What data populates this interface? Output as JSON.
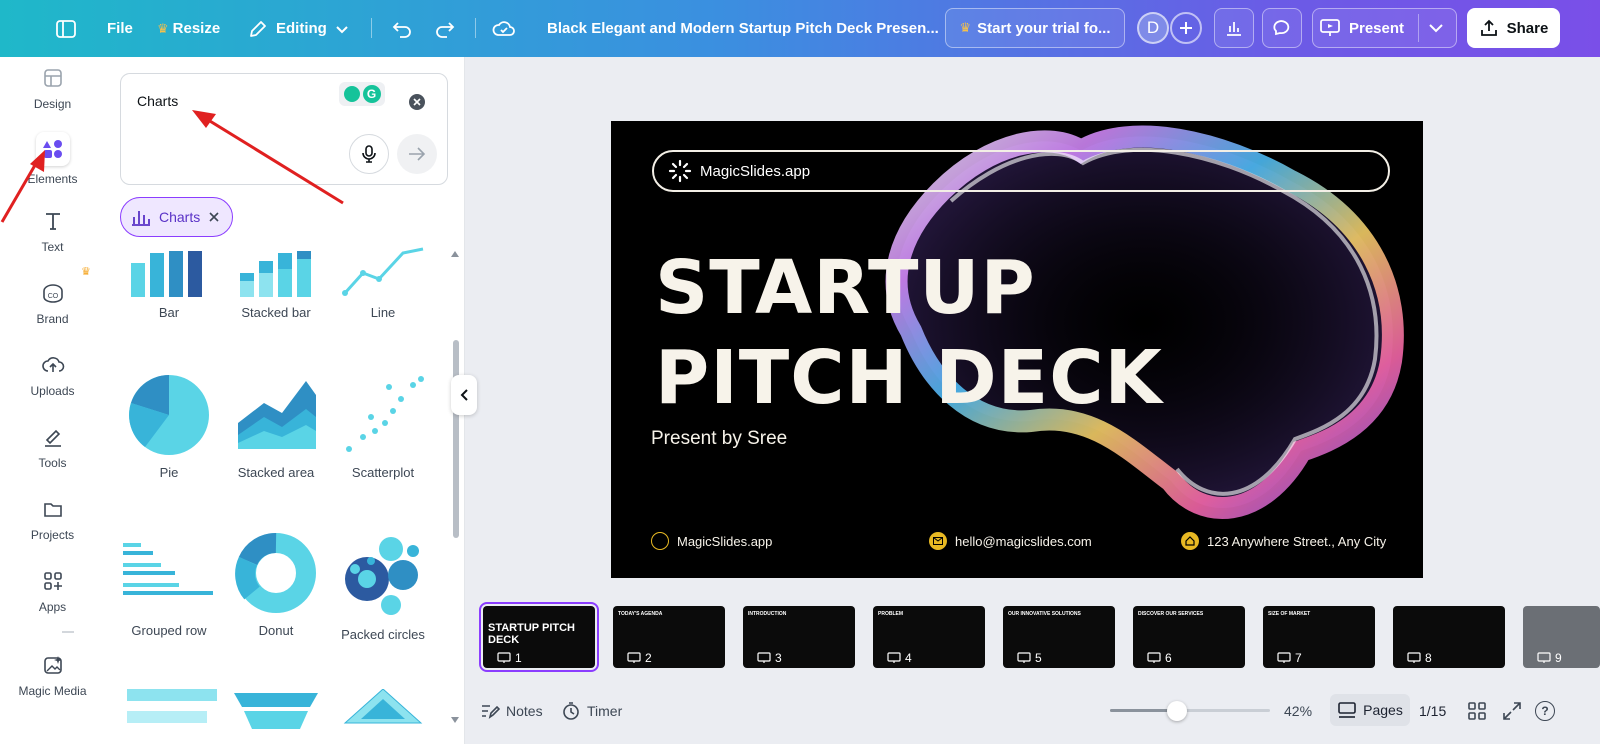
{
  "topbar": {
    "file_label": "File",
    "resize_label": "Resize",
    "editing_label": "Editing",
    "doc_title": "Black Elegant and Modern Startup Pitch Deck Presen...",
    "trial_label": "Start your trial fo...",
    "avatar_letter": "D",
    "present_label": "Present",
    "share_label": "Share"
  },
  "leftnav": {
    "items": [
      {
        "label": "Design",
        "icon": "design-icon"
      },
      {
        "label": "Elements",
        "icon": "elements-icon"
      },
      {
        "label": "Text",
        "icon": "text-icon"
      },
      {
        "label": "Brand",
        "icon": "brand-icon"
      },
      {
        "label": "Uploads",
        "icon": "upload-icon"
      },
      {
        "label": "Tools",
        "icon": "tools-icon"
      },
      {
        "label": "Projects",
        "icon": "folder-icon"
      },
      {
        "label": "Apps",
        "icon": "apps-icon"
      },
      {
        "label": "Magic Media",
        "icon": "magic-media-icon"
      }
    ]
  },
  "panel": {
    "search_value": "Charts",
    "filter_chip": "Charts",
    "tiles": [
      "Bar",
      "Stacked bar",
      "Line",
      "Pie",
      "Stacked area",
      "Scatterplot",
      "Grouped row",
      "Donut",
      "Packed circles"
    ]
  },
  "slide": {
    "brand": "MagicSlides.app",
    "title_line1": "STARTUP",
    "title_line2": "PITCH DECK",
    "subtitle": "Present by Sree",
    "footer_site": "MagicSlides.app",
    "footer_email": "hello@magicslides.com",
    "footer_address": "123 Anywhere Street., Any City"
  },
  "thumbnails": [
    {
      "num": "1",
      "title": "STARTUP PITCH DECK"
    },
    {
      "num": "2",
      "title": "TODAY'S AGENDA"
    },
    {
      "num": "3",
      "title": "INTRODUCTION"
    },
    {
      "num": "4",
      "title": "PROBLEM"
    },
    {
      "num": "5",
      "title": "OUR INNOVATIVE SOLUTIONS"
    },
    {
      "num": "6",
      "title": "DISCOVER OUR SERVICES"
    },
    {
      "num": "7",
      "title": "SIZE OF MARKET"
    },
    {
      "num": "8",
      "title": ""
    },
    {
      "num": "9",
      "title": ""
    }
  ],
  "bottombar": {
    "notes_label": "Notes",
    "timer_label": "Timer",
    "zoom_label": "42%",
    "zoom_fraction": 0.42,
    "pages_label": "Pages",
    "page_count": "1/15",
    "help_label": "?"
  },
  "colors": {
    "accent": "#8b3dff",
    "chart_teal": "#5ad4e6",
    "chart_blue": "#2f8fc4",
    "chart_navy": "#2c5aa0"
  }
}
